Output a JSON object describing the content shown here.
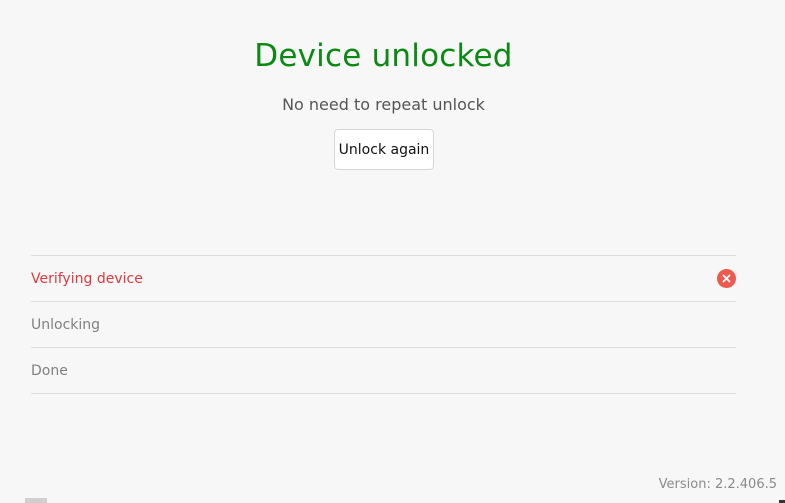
{
  "header": {
    "title": "Device unlocked",
    "subtitle": "No need to repeat unlock"
  },
  "actions": {
    "unlock_again_label": "Unlock again"
  },
  "steps": [
    {
      "label": "Verifying device",
      "status": "error",
      "icon": "error-x-icon"
    },
    {
      "label": "Unlocking",
      "status": "pending"
    },
    {
      "label": "Done",
      "status": "pending"
    }
  ],
  "footer": {
    "version": "Version: 2.2.406.5"
  },
  "colors": {
    "success_title": "#0a8a12",
    "error_text": "#e0393e",
    "error_icon": "#ef5a4f",
    "muted_text": "#808080",
    "background": "#f7f7f7"
  }
}
